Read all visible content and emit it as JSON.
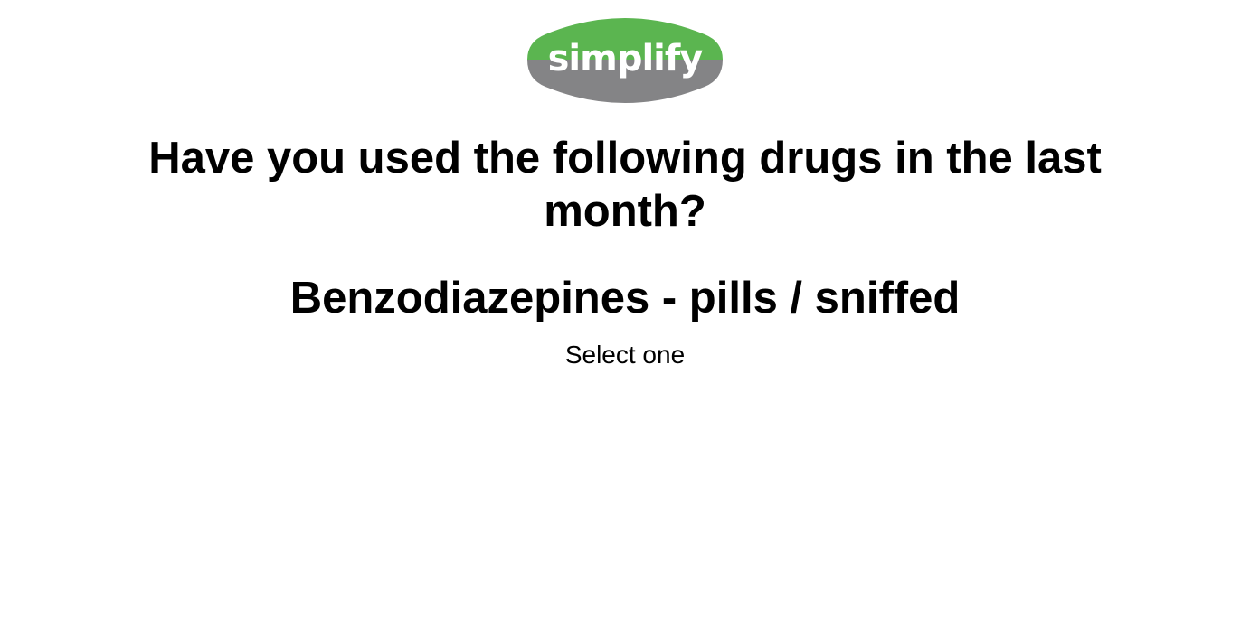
{
  "logo": {
    "text": "simplify",
    "colors": {
      "top": "#5bb550",
      "bottom": "#848486",
      "text": "#ffffff"
    }
  },
  "question": {
    "heading": "Have you used the following drugs in the last month?",
    "drug": "Benzodiazepines - pills / sniffed",
    "instruction": "Select one"
  }
}
